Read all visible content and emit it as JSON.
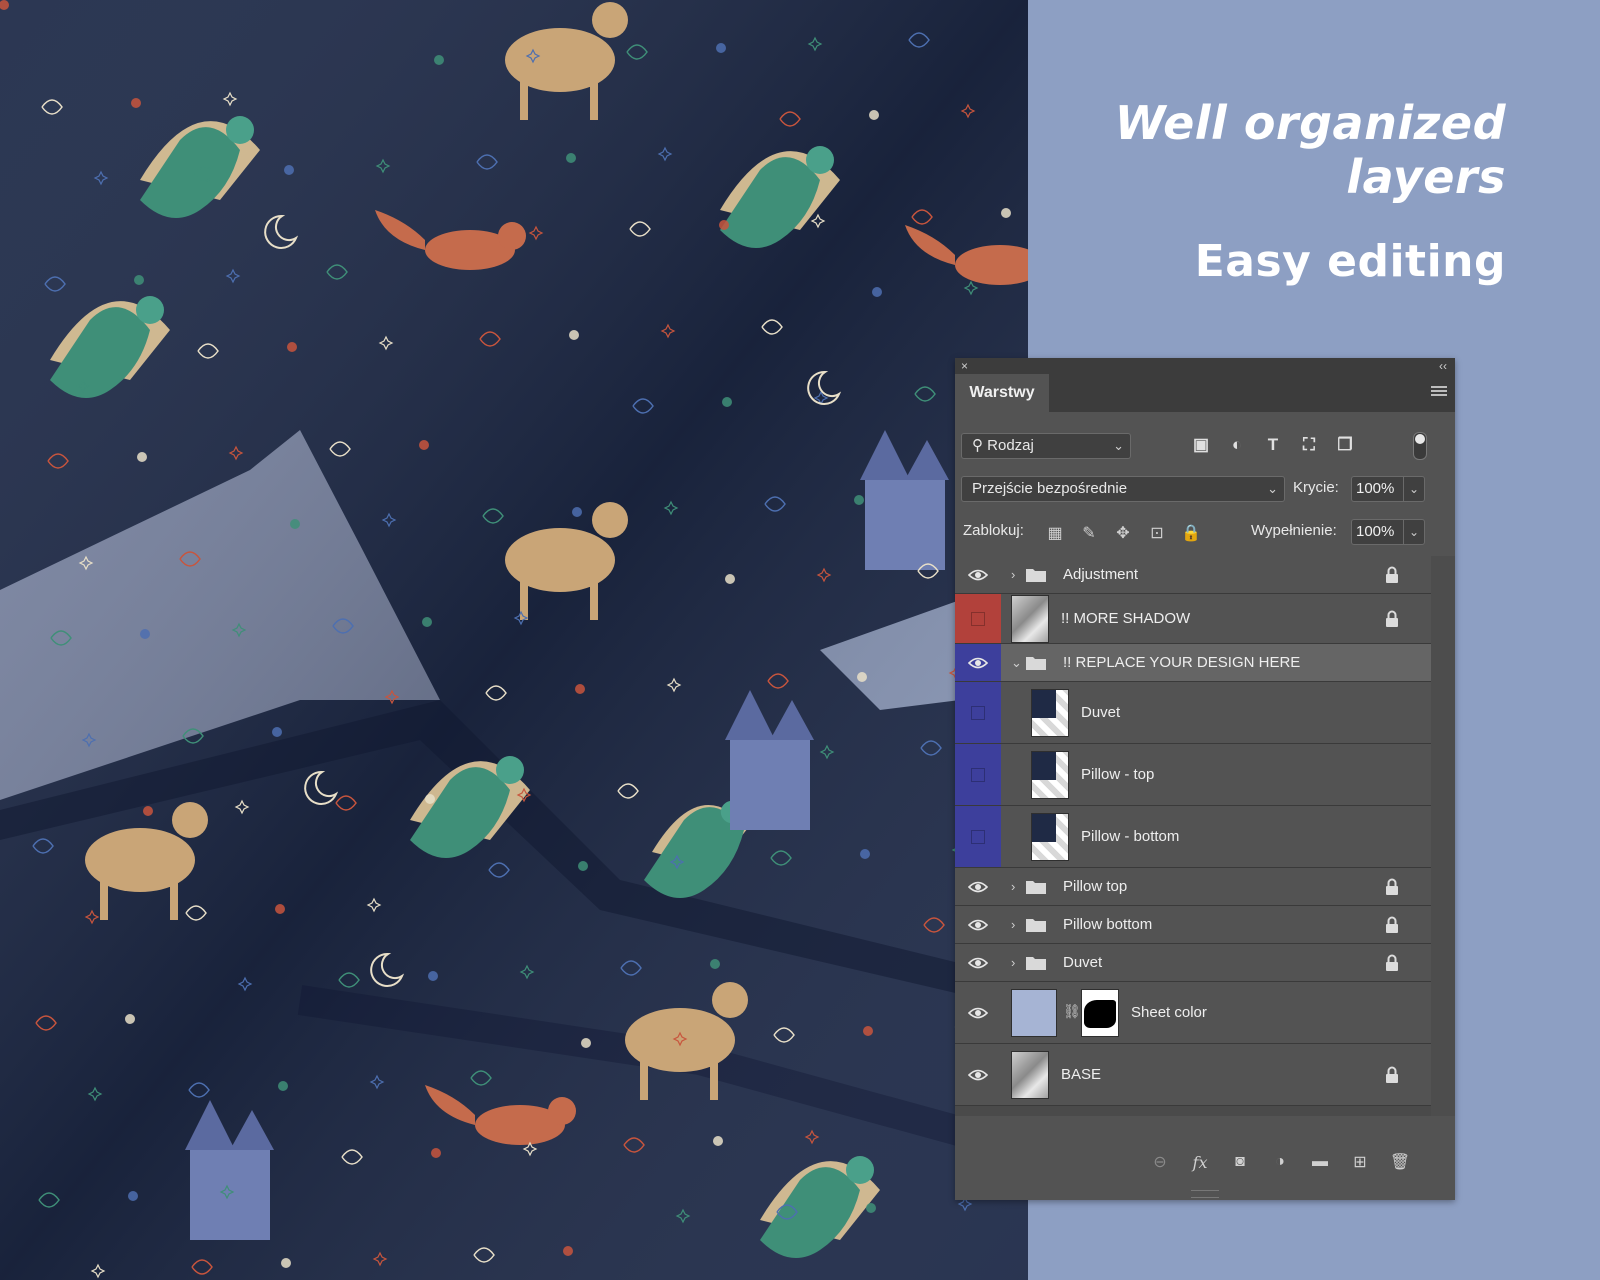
{
  "headline": {
    "line1": "Well organized",
    "line2": "layers",
    "line3": "Easy editing"
  },
  "panel": {
    "close_glyph": "×",
    "collapse_glyph": "‹‹",
    "tab_label": "Warstwy",
    "filter": {
      "label": "Rodzaj",
      "icon": "search-icon"
    },
    "filter_icons": [
      "image-filter-icon",
      "adjustment-filter-icon",
      "type-filter-icon",
      "shape-filter-icon",
      "smart-object-filter-icon"
    ],
    "filter_glyphs": [
      "▣",
      "◐",
      "T",
      "⛶",
      "❐"
    ],
    "blend_mode": "Przejście bezpośrednie",
    "opacity_label": "Krycie:",
    "opacity_value": "100%",
    "lock_label": "Zablokuj:",
    "lock_glyphs": [
      "▦",
      "✎",
      "✥",
      "⊡",
      "🔒"
    ],
    "fill_label": "Wypełnienie:",
    "fill_value": "100%",
    "layers": [
      {
        "name": "Adjustment",
        "type": "group",
        "visible": true,
        "expanded": false,
        "locked": true,
        "indent": 0
      },
      {
        "name": "!! MORE SHADOW",
        "type": "layer",
        "visible": false,
        "color": "#b2413b",
        "locked": true,
        "indent": 0
      },
      {
        "name": "!! REPLACE YOUR DESIGN HERE",
        "type": "group",
        "visible": true,
        "color": "#3d3f9c",
        "expanded": true,
        "locked": false,
        "selected": true,
        "indent": 0
      },
      {
        "name": "Duvet",
        "type": "smart",
        "visible": false,
        "color": "#3d3f9c",
        "locked": false,
        "indent": 1
      },
      {
        "name": "Pillow - top",
        "type": "smart",
        "visible": false,
        "color": "#3d3f9c",
        "locked": false,
        "indent": 1
      },
      {
        "name": "Pillow - bottom",
        "type": "smart",
        "visible": false,
        "color": "#3d3f9c",
        "locked": false,
        "indent": 1
      },
      {
        "name": "Pillow top",
        "type": "group",
        "visible": true,
        "expanded": false,
        "locked": true,
        "indent": 0
      },
      {
        "name": "Pillow bottom",
        "type": "group",
        "visible": true,
        "expanded": false,
        "locked": true,
        "indent": 0
      },
      {
        "name": "Duvet",
        "type": "group",
        "visible": true,
        "expanded": false,
        "locked": true,
        "indent": 0
      },
      {
        "name": "Sheet color",
        "type": "fill-mask",
        "visible": true,
        "locked": false,
        "indent": 0,
        "fill_color": "#a6b4d4"
      },
      {
        "name": "BASE",
        "type": "layer",
        "visible": true,
        "locked": true,
        "indent": 0
      }
    ],
    "bottom_icons": [
      "link-icon",
      "fx-icon",
      "mask-icon",
      "adjustment-icon",
      "new-group-icon",
      "new-layer-icon",
      "trash-icon"
    ],
    "bottom_glyphs": [
      "⊖",
      "fx",
      "◙",
      "◑",
      "▬",
      "⊞",
      "🗑"
    ]
  },
  "colors": {
    "background": "#8d9fc3",
    "fabric": "#1e2a48",
    "red_label": "#b2413b",
    "blue_label": "#3d3f9c"
  }
}
